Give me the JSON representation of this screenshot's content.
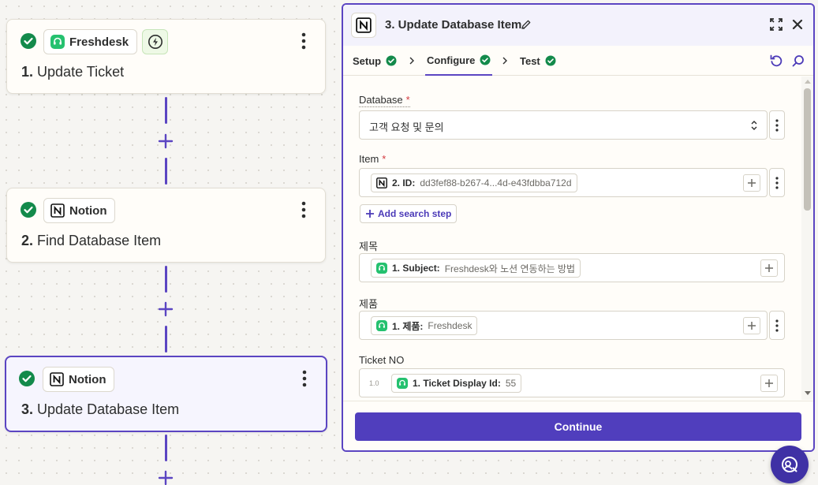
{
  "colors": {
    "accent": "#5b45c2",
    "success": "#138a4b",
    "freshdesk": "#25c16f",
    "required": "#d3393e",
    "button": "#503ebd"
  },
  "canvas": {
    "steps": [
      {
        "app": "Freshdesk",
        "number": "1.",
        "title": "Update Ticket",
        "status_icon": "check-circle-icon",
        "has_trigger_bolt": true
      },
      {
        "app": "Notion",
        "number": "2.",
        "title": "Find Database Item",
        "status_icon": "check-circle-icon"
      },
      {
        "app": "Notion",
        "number": "3.",
        "title": "Update Database Item",
        "status_icon": "check-circle-icon",
        "selected": true
      }
    ]
  },
  "panel": {
    "title": "3. Update Database Item",
    "tabs": [
      {
        "label": "Setup",
        "complete": true
      },
      {
        "label": "Configure",
        "complete": true,
        "active": true
      },
      {
        "label": "Test",
        "complete": true
      }
    ],
    "fields": {
      "database": {
        "label": "Database",
        "required": true,
        "value": "고객 요청 및 문의"
      },
      "item": {
        "label": "Item",
        "required": true,
        "token_key": "2. ID:",
        "token_value": "dd3fef88-b267-4...4d-e43fdbba712d",
        "add_search_label": "Add search step"
      },
      "title_field": {
        "label": "제목",
        "token_key": "1. Subject:",
        "token_value": "Freshdesk와 노션 연동하는 방법"
      },
      "product_field": {
        "label": "제품",
        "token_key": "1. 제품:",
        "token_value": "Freshdesk"
      },
      "ticket_no": {
        "label": "Ticket NO",
        "type_hint": "1.0",
        "token_key": "1. Ticket Display Id:",
        "token_value": "55"
      }
    },
    "continue_label": "Continue"
  }
}
